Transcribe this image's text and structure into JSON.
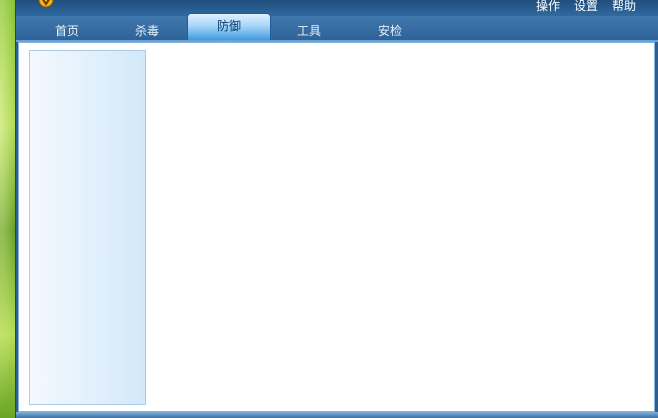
{
  "top_menu": {
    "operate": "操作",
    "settings": "设置",
    "help": "帮助"
  },
  "tabs": [
    {
      "label": "首页",
      "active": false
    },
    {
      "label": "杀毒",
      "active": false
    },
    {
      "label": "防御",
      "active": true
    },
    {
      "label": "工具",
      "active": false
    },
    {
      "label": "安检",
      "active": false
    }
  ],
  "colors": {
    "titlebar": "#1f4d7c",
    "active_tab": "#3f9be0",
    "panel": "#d2e8f9"
  }
}
